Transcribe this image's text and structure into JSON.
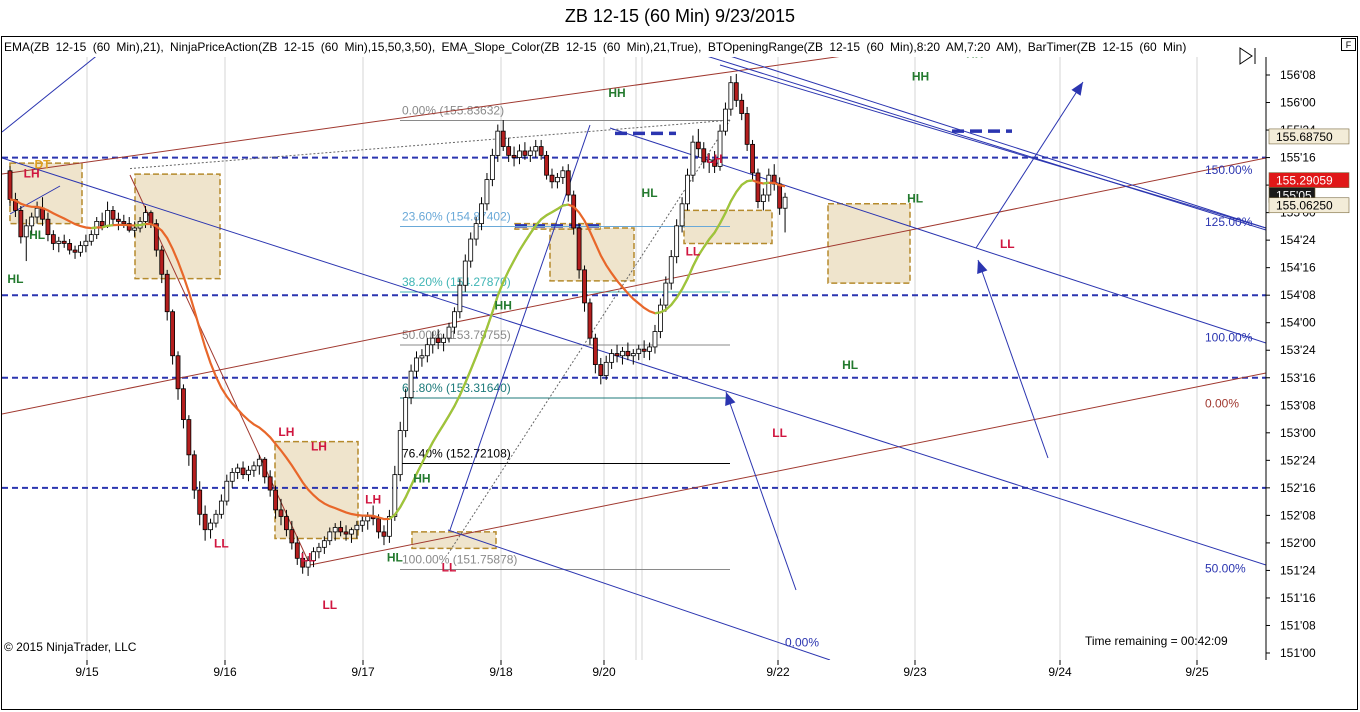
{
  "window": {
    "title": "ZB 12-15 (60 Min)  9/23/2015",
    "indicators": "EMA(ZB  12-15  (60  Min),21),  NinjaPriceAction(ZB  12-15  (60  Min),15,50,3,50),  EMA_Slope_Color(ZB  12-15  (60  Min),21,True),  BTOpeningRange(ZB  12-15  (60  Min),8:20  AM,7:20  AM),  BarTimer(ZB  12-15  (60  Min)",
    "f_button": "F",
    "copyright": "© 2015 NinjaTrader, LLC",
    "time_remaining": "Time remaining = 00:42:09"
  },
  "colors": {
    "up_candle": "#ffffff",
    "down_candle": "#b41e1e",
    "ema": "#e8672a",
    "ema_slope": "#9ac83c",
    "hh_hl": "#237a2e",
    "lh_ll": "#d0153f",
    "channel": "#2b35b0",
    "trendline": "#a0382f",
    "opening_range": "#efe4cc",
    "price_badge": "#e01818"
  },
  "chart_data": {
    "type": "candlestick",
    "title": "ZB 12-15 (60 Min)  9/23/2015",
    "x_labels": [
      "9/15",
      "9/16",
      "9/17",
      "9/18",
      "9/20",
      "9/22",
      "9/23",
      "9/24",
      "9/25"
    ],
    "y_labels": [
      "156'08",
      "156'00",
      "155'24",
      "155'16",
      "155'08",
      "155'00",
      "154'24",
      "154'16",
      "154'08",
      "154'00",
      "153'24",
      "153'16",
      "153'08",
      "153'00",
      "152'24",
      "152'16",
      "152'08",
      "152'00",
      "151'24",
      "151'16",
      "151'08",
      "151'00"
    ],
    "ylim_ticks": [
      151.0,
      156.25
    ],
    "price_badges": [
      {
        "text": "155.68750",
        "value": 155.6875,
        "style": "light"
      },
      {
        "text": "155.29059",
        "value": 155.29059,
        "style": "red"
      },
      {
        "text": "155'05",
        "value": 155.15625,
        "style": "dark"
      },
      {
        "text": "155.06250",
        "value": 155.0625,
        "style": "light"
      }
    ],
    "horizontal_levels": [
      155.5,
      154.25,
      153.5,
      152.5
    ],
    "fibonacci": {
      "levels": [
        {
          "label": "0.00% (155.83632)",
          "value": 155.83632
        },
        {
          "label": "23.60% (154.87402)",
          "value": 154.87402
        },
        {
          "label": "38.20% (154.27870)",
          "value": 154.2787
        },
        {
          "label": "50.00% (153.79755)",
          "value": 153.79755
        },
        {
          "label": "61.80% (153.31640)",
          "value": 153.3164
        },
        {
          "label": "76.40% (152.72108)",
          "value": 152.72108
        },
        {
          "label": "100.00% (151.75878)",
          "value": 151.75878
        }
      ]
    },
    "channel_labels": [
      {
        "label": "150.00%",
        "value": 155.35
      },
      {
        "label": "125.00%",
        "value": 154.88
      },
      {
        "label": "100.00%",
        "value": 153.83
      },
      {
        "label": "50.00%",
        "value": 151.73
      },
      {
        "label": "0.00%",
        "value": 153.23
      },
      {
        "label": "0.00%",
        "value": 151.06
      }
    ],
    "swing_labels": [
      {
        "text": "DT",
        "bar": 6,
        "value": 155.4
      },
      {
        "text": "LH",
        "bar": 4,
        "value": 155.32
      },
      {
        "text": "HL",
        "bar": 5,
        "value": 154.76
      },
      {
        "text": "HL",
        "bar": 1,
        "value": 154.36
      },
      {
        "text": "LL",
        "bar": 39,
        "value": 151.96
      },
      {
        "text": "LH",
        "bar": 51,
        "value": 152.97
      },
      {
        "text": "LH",
        "bar": 57,
        "value": 152.84
      },
      {
        "text": "LL",
        "bar": 55,
        "value": 151.83
      },
      {
        "text": "LL",
        "bar": 59,
        "value": 151.4
      },
      {
        "text": "LH",
        "bar": 67,
        "value": 152.36
      },
      {
        "text": "HL",
        "bar": 71,
        "value": 151.83
      },
      {
        "text": "HH",
        "bar": 76,
        "value": 152.55
      },
      {
        "text": "LL",
        "bar": 81,
        "value": 151.74
      },
      {
        "text": "HH",
        "bar": 91,
        "value": 154.12
      },
      {
        "text": "HH",
        "bar": 112,
        "value": 156.05
      },
      {
        "text": "HL",
        "bar": 118,
        "value": 155.14
      },
      {
        "text": "LH",
        "bar": 130,
        "value": 155.45
      },
      {
        "text": "LL",
        "bar": 126,
        "value": 154.61
      },
      {
        "text": "LL",
        "bar": 142,
        "value": 152.96
      },
      {
        "text": "HL",
        "bar": 155,
        "value": 153.58
      },
      {
        "text": "HH",
        "bar": 168,
        "value": 156.2
      },
      {
        "text": "HL",
        "bar": 167,
        "value": 155.09
      },
      {
        "text": "HH",
        "bar": 178,
        "value": 156.41
      },
      {
        "text": "LL",
        "bar": 184,
        "value": 154.68
      }
    ],
    "candles_ohlc": [
      [
        155.38,
        155.42,
        155.06,
        155.12
      ],
      [
        155.12,
        155.18,
        154.96,
        155.02
      ],
      [
        155.02,
        155.06,
        154.72,
        154.78
      ],
      [
        154.78,
        154.94,
        154.56,
        154.88
      ],
      [
        154.88,
        155.0,
        154.8,
        154.96
      ],
      [
        154.96,
        155.1,
        154.9,
        155.04
      ],
      [
        155.04,
        155.14,
        154.88,
        154.94
      ],
      [
        154.94,
        155.0,
        154.74,
        154.8
      ],
      [
        154.8,
        154.84,
        154.66,
        154.72
      ],
      [
        154.72,
        154.78,
        154.64,
        154.74
      ],
      [
        154.74,
        154.8,
        154.68,
        154.72
      ],
      [
        154.72,
        154.76,
        154.62,
        154.66
      ],
      [
        154.66,
        154.7,
        154.58,
        154.64
      ],
      [
        154.64,
        154.74,
        154.6,
        154.7
      ],
      [
        154.7,
        154.8,
        154.64,
        154.74
      ],
      [
        154.74,
        154.84,
        154.7,
        154.8
      ],
      [
        154.8,
        154.96,
        154.76,
        154.92
      ],
      [
        154.92,
        155.0,
        154.84,
        154.88
      ],
      [
        154.88,
        155.1,
        154.86,
        155.02
      ],
      [
        155.02,
        155.06,
        154.88,
        154.94
      ],
      [
        154.94,
        155.0,
        154.84,
        154.92
      ],
      [
        154.92,
        154.98,
        154.86,
        154.9
      ],
      [
        154.9,
        154.96,
        154.82,
        154.84
      ],
      [
        154.84,
        154.92,
        154.78,
        154.86
      ],
      [
        154.86,
        154.96,
        154.82,
        154.92
      ],
      [
        154.92,
        155.06,
        154.86,
        155.0
      ],
      [
        155.0,
        155.02,
        154.86,
        154.9
      ],
      [
        154.9,
        154.94,
        154.6,
        154.66
      ],
      [
        154.66,
        154.7,
        154.36,
        154.44
      ],
      [
        154.44,
        154.48,
        154.02,
        154.1
      ],
      [
        154.1,
        154.12,
        153.62,
        153.7
      ],
      [
        153.7,
        153.74,
        153.3,
        153.4
      ],
      [
        153.4,
        153.44,
        153.04,
        153.12
      ],
      [
        153.12,
        153.16,
        152.7,
        152.8
      ],
      [
        152.8,
        152.84,
        152.4,
        152.48
      ],
      [
        152.48,
        152.56,
        152.16,
        152.26
      ],
      [
        152.26,
        152.34,
        152.02,
        152.12
      ],
      [
        152.12,
        152.22,
        152.04,
        152.18
      ],
      [
        152.18,
        152.3,
        152.14,
        152.26
      ],
      [
        152.26,
        152.44,
        152.22,
        152.38
      ],
      [
        152.38,
        152.62,
        152.34,
        152.56
      ],
      [
        152.56,
        152.68,
        152.5,
        152.64
      ],
      [
        152.64,
        152.72,
        152.58,
        152.68
      ],
      [
        152.68,
        152.74,
        152.58,
        152.62
      ],
      [
        152.62,
        152.7,
        152.56,
        152.66
      ],
      [
        152.66,
        152.74,
        152.6,
        152.7
      ],
      [
        152.7,
        152.8,
        152.62,
        152.76
      ],
      [
        152.76,
        152.78,
        152.54,
        152.6
      ],
      [
        152.6,
        152.66,
        152.42,
        152.48
      ],
      [
        152.48,
        152.52,
        152.22,
        152.3
      ],
      [
        152.3,
        152.4,
        152.16,
        152.24
      ],
      [
        152.24,
        152.3,
        152.06,
        152.12
      ],
      [
        152.12,
        152.2,
        151.94,
        152.0
      ],
      [
        152.0,
        152.06,
        151.8,
        151.86
      ],
      [
        151.86,
        151.92,
        151.72,
        151.78
      ],
      [
        151.78,
        151.88,
        151.7,
        151.84
      ],
      [
        151.84,
        151.96,
        151.78,
        151.92
      ],
      [
        151.92,
        152.0,
        151.86,
        151.96
      ],
      [
        151.96,
        152.06,
        151.9,
        152.02
      ],
      [
        152.02,
        152.14,
        151.98,
        152.1
      ],
      [
        152.1,
        152.18,
        152.02,
        152.14
      ],
      [
        152.14,
        152.2,
        152.06,
        152.1
      ],
      [
        152.1,
        152.16,
        152.02,
        152.08
      ],
      [
        152.08,
        152.14,
        152.0,
        152.12
      ],
      [
        152.12,
        152.2,
        152.04,
        152.16
      ],
      [
        152.16,
        152.24,
        152.1,
        152.2
      ],
      [
        152.2,
        152.28,
        152.12,
        152.24
      ],
      [
        152.24,
        152.34,
        152.16,
        152.22
      ],
      [
        152.22,
        152.26,
        152.04,
        152.1
      ],
      [
        152.1,
        152.16,
        151.98,
        152.06
      ],
      [
        152.06,
        152.3,
        152.0,
        152.24
      ],
      [
        152.24,
        152.7,
        152.2,
        152.62
      ],
      [
        152.62,
        153.1,
        152.56,
        153.02
      ],
      [
        153.02,
        153.4,
        152.96,
        153.32
      ],
      [
        153.32,
        153.62,
        153.26,
        153.56
      ],
      [
        153.56,
        153.74,
        153.5,
        153.68
      ],
      [
        153.68,
        153.76,
        153.6,
        153.7
      ],
      [
        153.7,
        153.86,
        153.64,
        153.8
      ],
      [
        153.8,
        153.92,
        153.72,
        153.86
      ],
      [
        153.86,
        153.94,
        153.76,
        153.82
      ],
      [
        153.82,
        153.9,
        153.74,
        153.86
      ],
      [
        153.86,
        154.0,
        153.82,
        153.96
      ],
      [
        153.96,
        154.14,
        153.9,
        154.1
      ],
      [
        154.1,
        154.4,
        154.04,
        154.34
      ],
      [
        154.34,
        154.62,
        154.28,
        154.56
      ],
      [
        154.56,
        154.82,
        154.5,
        154.76
      ],
      [
        154.76,
        154.96,
        154.7,
        154.9
      ],
      [
        154.9,
        155.14,
        154.84,
        155.08
      ],
      [
        155.08,
        155.36,
        155.02,
        155.3
      ],
      [
        155.3,
        155.58,
        155.24,
        155.52
      ],
      [
        155.52,
        155.8,
        155.46,
        155.74
      ],
      [
        155.74,
        155.84,
        155.56,
        155.6
      ],
      [
        155.6,
        155.68,
        155.46,
        155.52
      ],
      [
        155.52,
        155.6,
        155.42,
        155.5
      ],
      [
        155.5,
        155.62,
        155.44,
        155.56
      ],
      [
        155.56,
        155.64,
        155.48,
        155.52
      ],
      [
        155.52,
        155.6,
        155.46,
        155.56
      ],
      [
        155.56,
        155.66,
        155.5,
        155.6
      ],
      [
        155.6,
        155.66,
        155.48,
        155.52
      ],
      [
        155.52,
        155.56,
        155.3,
        155.34
      ],
      [
        155.34,
        155.4,
        155.22,
        155.28
      ],
      [
        155.28,
        155.36,
        155.22,
        155.32
      ],
      [
        155.32,
        155.42,
        155.26,
        155.38
      ],
      [
        155.38,
        155.44,
        155.1,
        155.16
      ],
      [
        155.16,
        155.2,
        154.8,
        154.86
      ],
      [
        154.86,
        154.9,
        154.4,
        154.48
      ],
      [
        154.48,
        154.52,
        154.1,
        154.18
      ],
      [
        154.18,
        154.22,
        153.8,
        153.86
      ],
      [
        153.86,
        153.9,
        153.54,
        153.62
      ],
      [
        153.62,
        153.68,
        153.44,
        153.52
      ],
      [
        153.52,
        153.7,
        153.48,
        153.64
      ],
      [
        153.64,
        153.76,
        153.58,
        153.72
      ],
      [
        153.72,
        153.8,
        153.64,
        153.7
      ],
      [
        153.7,
        153.78,
        153.62,
        153.74
      ],
      [
        153.74,
        153.82,
        153.66,
        153.7
      ],
      [
        153.7,
        153.76,
        153.62,
        153.72
      ],
      [
        153.72,
        153.8,
        153.66,
        153.76
      ],
      [
        153.76,
        153.84,
        153.68,
        153.74
      ],
      [
        153.74,
        153.82,
        153.66,
        153.78
      ],
      [
        153.78,
        153.98,
        153.72,
        153.92
      ],
      [
        153.92,
        154.22,
        153.86,
        154.16
      ],
      [
        154.16,
        154.42,
        154.1,
        154.36
      ],
      [
        154.36,
        154.66,
        154.3,
        154.6
      ],
      [
        154.6,
        154.94,
        154.54,
        154.88
      ],
      [
        154.88,
        155.14,
        154.82,
        155.08
      ],
      [
        155.08,
        155.4,
        155.02,
        155.34
      ],
      [
        155.34,
        155.7,
        155.28,
        155.64
      ],
      [
        155.64,
        155.76,
        155.5,
        155.58
      ],
      [
        155.58,
        155.64,
        155.4,
        155.46
      ],
      [
        155.46,
        155.54,
        155.36,
        155.48
      ],
      [
        155.48,
        155.56,
        155.36,
        155.42
      ],
      [
        155.42,
        155.8,
        155.38,
        155.74
      ],
      [
        155.74,
        156.0,
        155.7,
        155.94
      ],
      [
        155.94,
        156.24,
        155.88,
        156.18
      ],
      [
        156.18,
        156.26,
        155.96,
        156.02
      ],
      [
        156.02,
        156.08,
        155.84,
        155.9
      ],
      [
        155.9,
        155.96,
        155.56,
        155.62
      ],
      [
        155.62,
        155.66,
        155.3,
        155.36
      ],
      [
        155.36,
        155.4,
        155.04,
        155.1
      ],
      [
        155.1,
        155.22,
        155.02,
        155.16
      ],
      [
        155.16,
        155.4,
        155.1,
        155.34
      ],
      [
        155.34,
        155.44,
        155.2,
        155.26
      ],
      [
        155.26,
        155.32,
        154.98,
        155.04
      ],
      [
        155.04,
        155.18,
        154.82,
        155.14
      ]
    ]
  }
}
